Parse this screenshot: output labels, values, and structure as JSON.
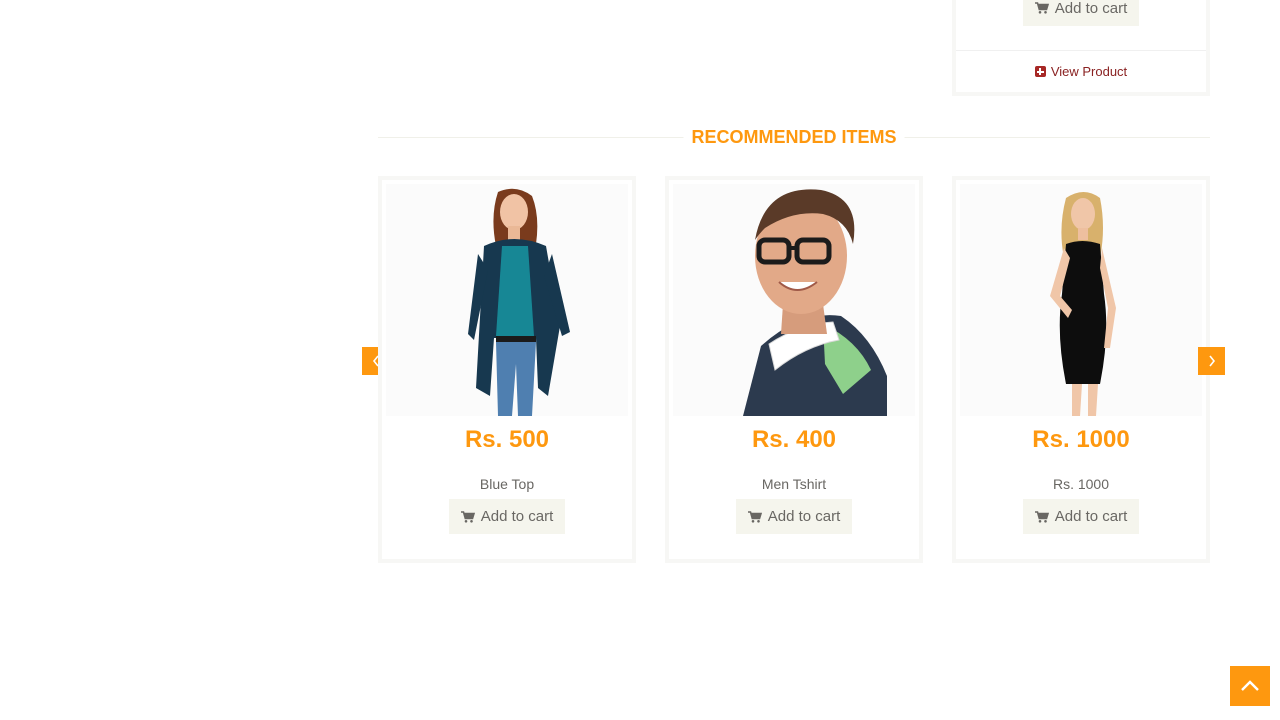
{
  "top_card": {
    "add_to_cart_label": "Add to cart",
    "view_product_label": "View Product"
  },
  "section": {
    "title": "RECOMMENDED ITEMS"
  },
  "products": [
    {
      "price": "Rs. 500",
      "name": "Blue Top",
      "add_to_cart_label": "Add to cart",
      "image": "woman-blue-top-photo"
    },
    {
      "price": "Rs. 400",
      "name": "Men Tshirt",
      "add_to_cart_label": "Add to cart",
      "image": "man-tshirt-photo"
    },
    {
      "price": "Rs. 1000",
      "name": "Rs. 1000",
      "add_to_cart_label": "Add to cart",
      "image": "woman-black-dress-photo"
    }
  ],
  "icons": {
    "cart": "cart-icon",
    "plus": "plus-square-icon",
    "carousel_prev": "chevron-left-icon",
    "carousel_next": "chevron-right-icon",
    "scroll_up": "chevron-up-icon"
  },
  "colors": {
    "accent": "#fe980f",
    "text": "#696763",
    "view_product": "#8a2222",
    "button_bg": "#f5f5ed"
  }
}
